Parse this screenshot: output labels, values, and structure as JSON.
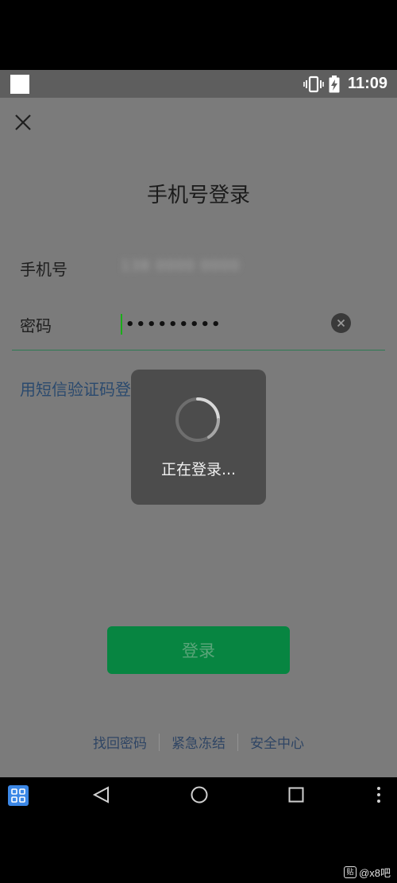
{
  "status_bar": {
    "time": "11:09",
    "icons": [
      "vibrate-icon",
      "battery-charging-icon"
    ]
  },
  "page": {
    "title": "手机号登录"
  },
  "form": {
    "phone_label": "手机号",
    "phone_value_masked": "138 0000 0000",
    "password_label": "密码",
    "password_dots": "•••••••••"
  },
  "sms_login_link": "用短信验证码登录",
  "loading_toast": {
    "text": "正在登录..."
  },
  "login_button": {
    "label": "登录"
  },
  "footer": {
    "links": [
      "找回密码",
      "紧急冻结",
      "安全中心"
    ]
  },
  "watermark": {
    "text": "@x8吧",
    "badge": "贴"
  },
  "colors": {
    "accent_green": "#078541",
    "link_blue": "#2b4a6e",
    "overlay_toast": "#4c4c4c"
  }
}
